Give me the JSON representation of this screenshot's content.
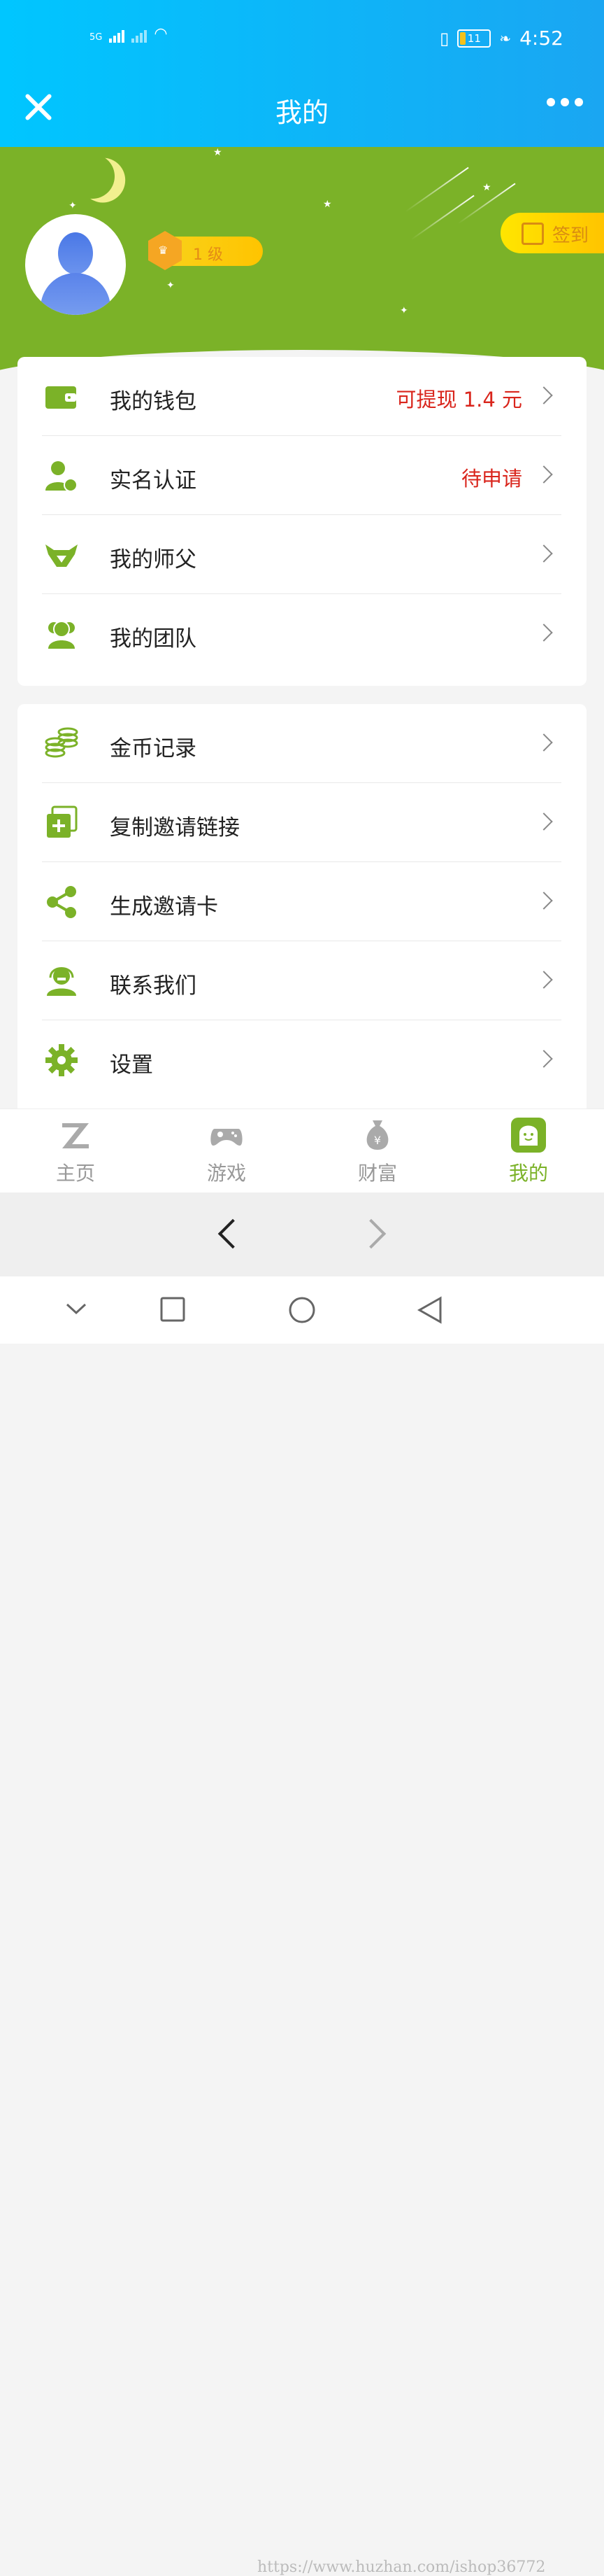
{
  "status_bar": {
    "network": "5G",
    "battery": "11",
    "time": "4:52"
  },
  "header": {
    "title": "我的"
  },
  "profile": {
    "level": "1 级",
    "signin_label": "签到"
  },
  "menu_group_1": [
    {
      "label": "我的钱包",
      "value": "可提现 1.4 元",
      "icon": "wallet-icon"
    },
    {
      "label": "实名认证",
      "value": "待申请",
      "icon": "user-verify-icon"
    },
    {
      "label": "我的师父",
      "value": "",
      "icon": "master-icon"
    },
    {
      "label": "我的团队",
      "value": "",
      "icon": "team-icon"
    }
  ],
  "menu_group_2": [
    {
      "label": "金币记录",
      "icon": "coins-icon"
    },
    {
      "label": "复制邀请链接",
      "icon": "copy-link-icon"
    },
    {
      "label": "生成邀请卡",
      "icon": "share-icon"
    },
    {
      "label": "联系我们",
      "icon": "support-icon"
    },
    {
      "label": "设置",
      "icon": "gear-icon"
    }
  ],
  "tabbar": [
    {
      "label": "主页",
      "icon": "home-z-icon"
    },
    {
      "label": "游戏",
      "icon": "gamepad-icon"
    },
    {
      "label": "财富",
      "icon": "money-bag-icon"
    },
    {
      "label": "我的",
      "icon": "profile-icon"
    }
  ],
  "watermark": "https://www.huzhan.com/ishop36772",
  "colors": {
    "header_blue": "#1aa6f2",
    "accent_green": "#7bb228",
    "value_red": "#d9251c",
    "badge_yellow": "#ffc400"
  }
}
